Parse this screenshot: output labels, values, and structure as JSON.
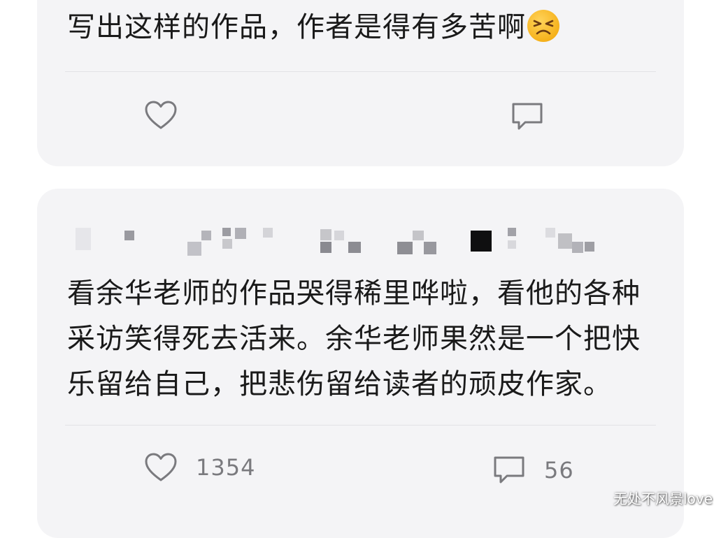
{
  "comments": [
    {
      "text": "写出这样的作品，作者是得有多苦啊",
      "emoji": "persevering-face",
      "like_count": "",
      "comment_count": ""
    },
    {
      "username_blurred": true,
      "text": "看余华老师的作品哭得稀里哗啦，看他的各种采访笑得死去活来。余华老师果然是一个把快乐留给自己，把悲伤留给读者的顽皮作家。",
      "like_count": "1354",
      "comment_count": "56"
    }
  ],
  "icons": {
    "like": "heart-outline-icon",
    "comment": "speech-bubble-icon"
  },
  "colors": {
    "card_background": "#f4f4f6",
    "text": "#1a1a1a",
    "icon_gray": "#7a7a7e"
  },
  "watermark": "无处不风景love"
}
